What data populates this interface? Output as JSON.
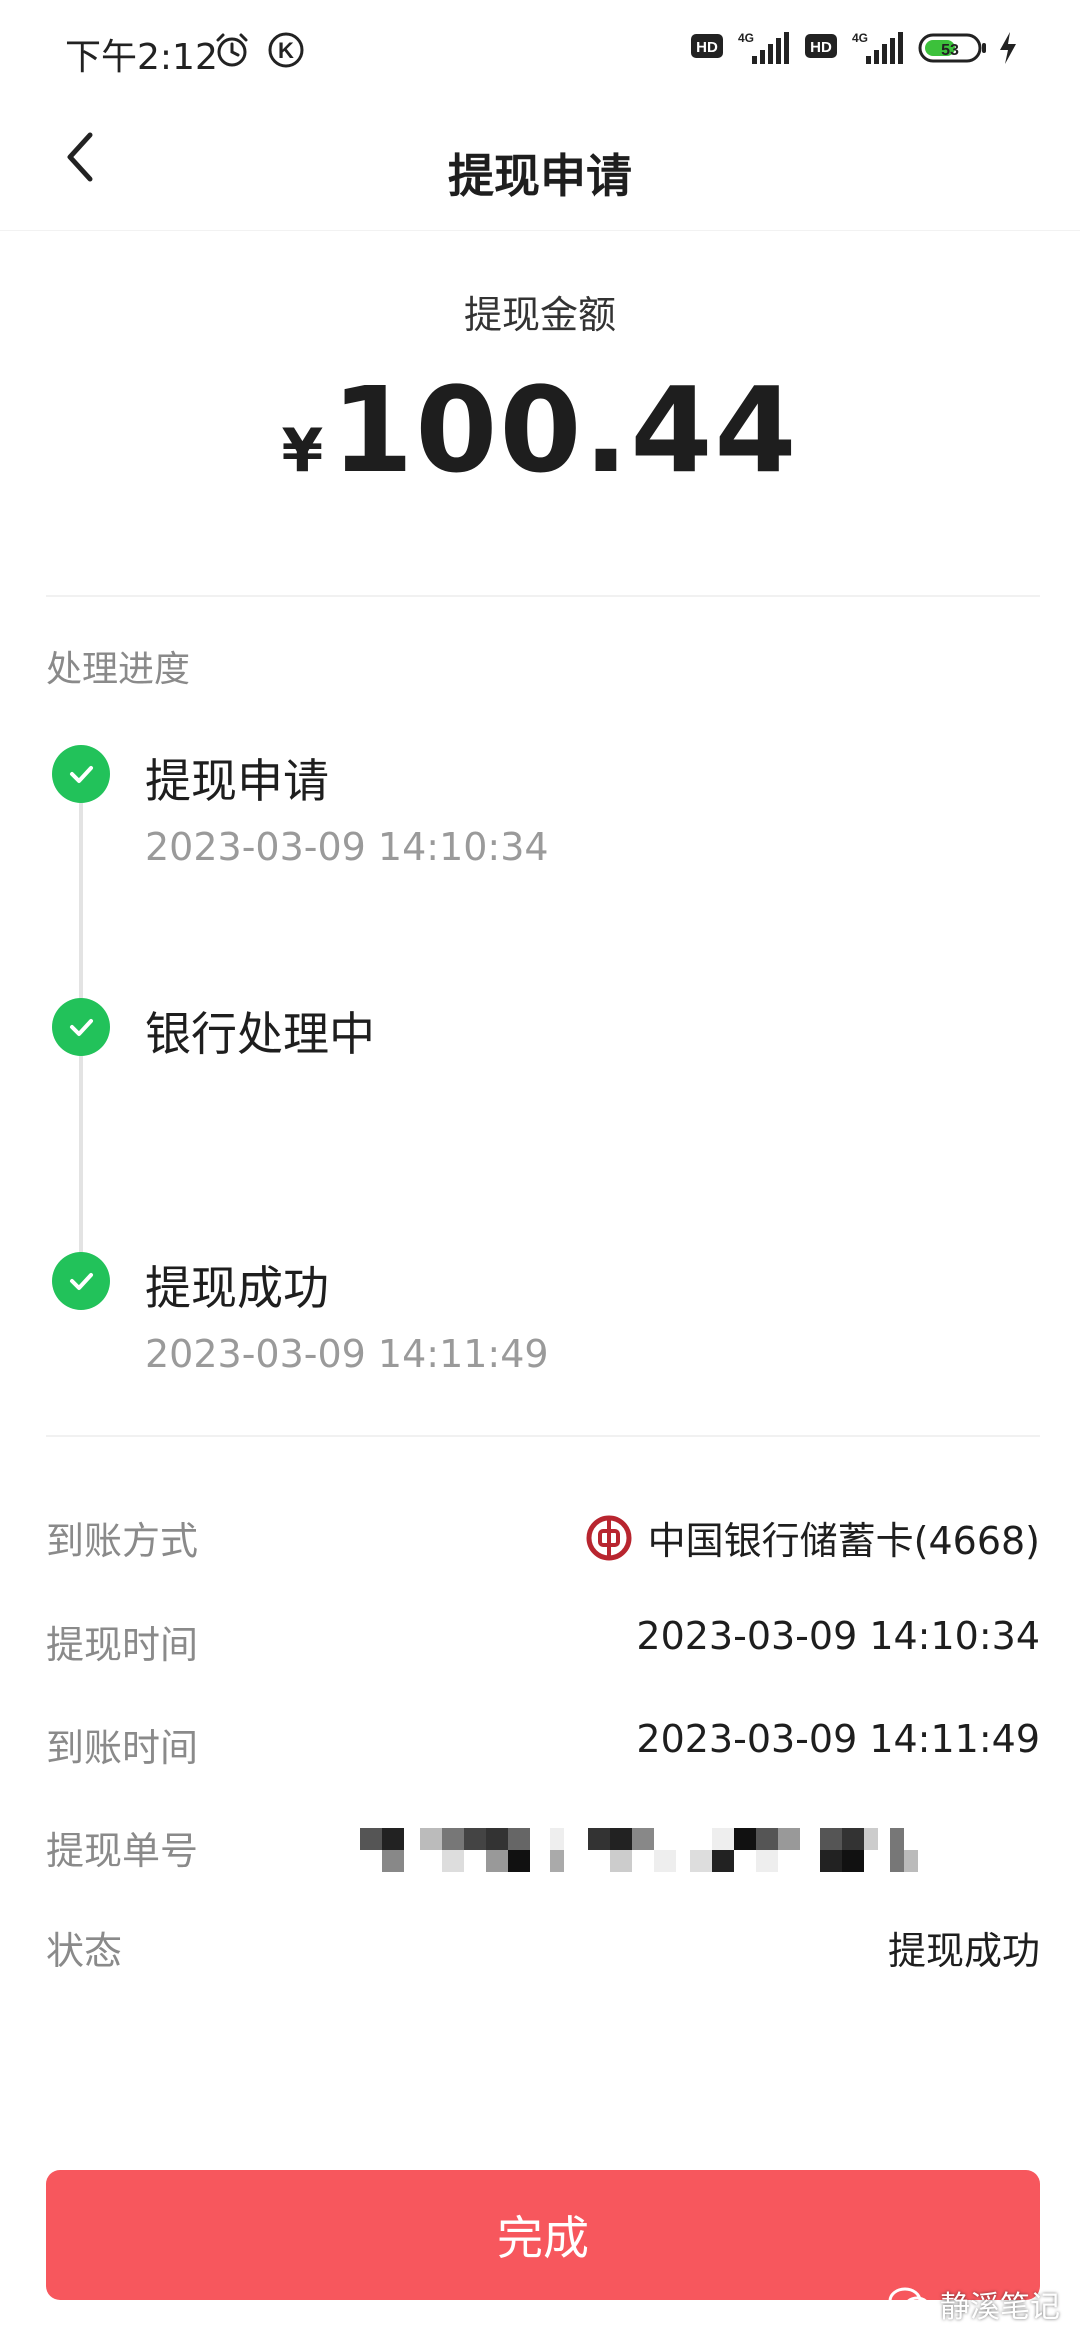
{
  "status_bar": {
    "time": "下午2:12",
    "battery": "53",
    "network_1": "4G",
    "network_2": "4G",
    "hd_1": "HD",
    "hd_2": "HD",
    "k_badge": "K"
  },
  "nav": {
    "title": "提现申请"
  },
  "amount": {
    "label": "提现金额",
    "currency": "¥",
    "value": "100.44"
  },
  "progress": {
    "title": "处理进度",
    "steps": [
      {
        "label": "提现申请",
        "time": "2023-03-09 14:10:34"
      },
      {
        "label": "银行处理中"
      },
      {
        "label": "提现成功",
        "time": "2023-03-09 14:11:49"
      }
    ]
  },
  "info": {
    "arrival_method": {
      "label": "到账方式",
      "value": "中国银行储蓄卡(4668)"
    },
    "withdraw_time": {
      "label": "提现时间",
      "value": "2023-03-09 14:10:34"
    },
    "arrival_time": {
      "label": "到账时间",
      "value": "2023-03-09 14:11:49"
    },
    "order_no": {
      "label": "提现单号"
    },
    "status": {
      "label": "状态",
      "value": "提现成功"
    }
  },
  "done_button": {
    "label": "完成"
  },
  "watermark": {
    "text": "静溪笔记"
  },
  "colors": {
    "accent": "#f7575d",
    "success": "#22c25a",
    "bank_red": "#b8252f"
  }
}
